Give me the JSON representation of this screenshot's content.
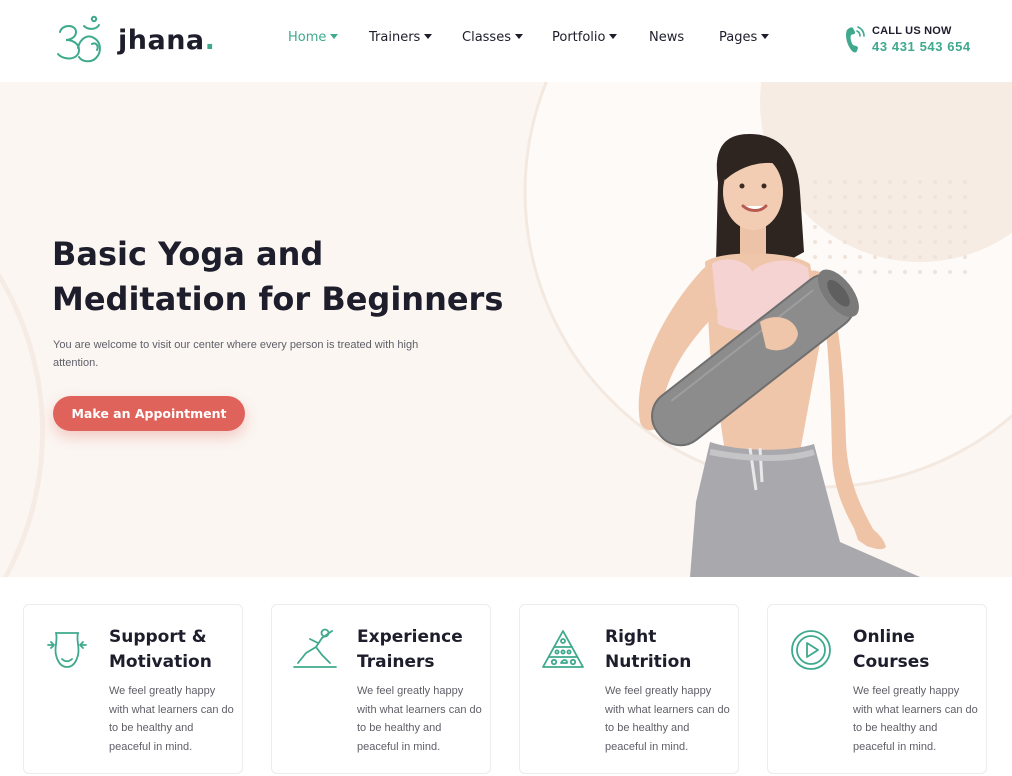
{
  "brand": {
    "name": "jhana",
    "dot": "."
  },
  "nav": [
    {
      "label": "Home",
      "dropdown": true,
      "active": true
    },
    {
      "label": "Trainers",
      "dropdown": true,
      "active": false
    },
    {
      "label": "Classes",
      "dropdown": true,
      "active": false
    },
    {
      "label": "Portfolio",
      "dropdown": true,
      "active": false
    },
    {
      "label": "News",
      "dropdown": false,
      "active": false
    },
    {
      "label": "Pages",
      "dropdown": true,
      "active": false
    }
  ],
  "call": {
    "label": "CALL US NOW",
    "number": "43 431 543 654",
    "icon": "phone-icon"
  },
  "hero": {
    "title_line1": "Basic Yoga and",
    "title_line2": "Meditation for Beginners",
    "text": "You are welcome to visit our center where every person is treated with high attention.",
    "cta_label": "Make an Appointment"
  },
  "features": [
    {
      "title_line1": "Support &",
      "title_line2": "Motivation",
      "text": "We feel greatly happy with what learners can do to be healthy and peaceful in mind.",
      "icon": "body-shape-icon"
    },
    {
      "title_line1": "Experience",
      "title_line2": "Trainers",
      "text": "We feel greatly happy with what learners can do to be healthy and peaceful in mind.",
      "icon": "yoga-pose-icon"
    },
    {
      "title_line1": "Right",
      "title_line2": "Nutrition",
      "text": "We feel greatly happy with what learners can do to be healthy and peaceful in mind.",
      "icon": "food-pyramid-icon"
    },
    {
      "title_line1": "Online",
      "title_line2": "Courses",
      "text": "We feel greatly happy with what learners can do to be healthy and peaceful in mind.",
      "icon": "play-circle-icon"
    }
  ],
  "colors": {
    "accent": "#3fa98d",
    "cta": "#e0635b",
    "hero_bg": "#fbf6f2",
    "text_dark": "#1d1d2b"
  }
}
